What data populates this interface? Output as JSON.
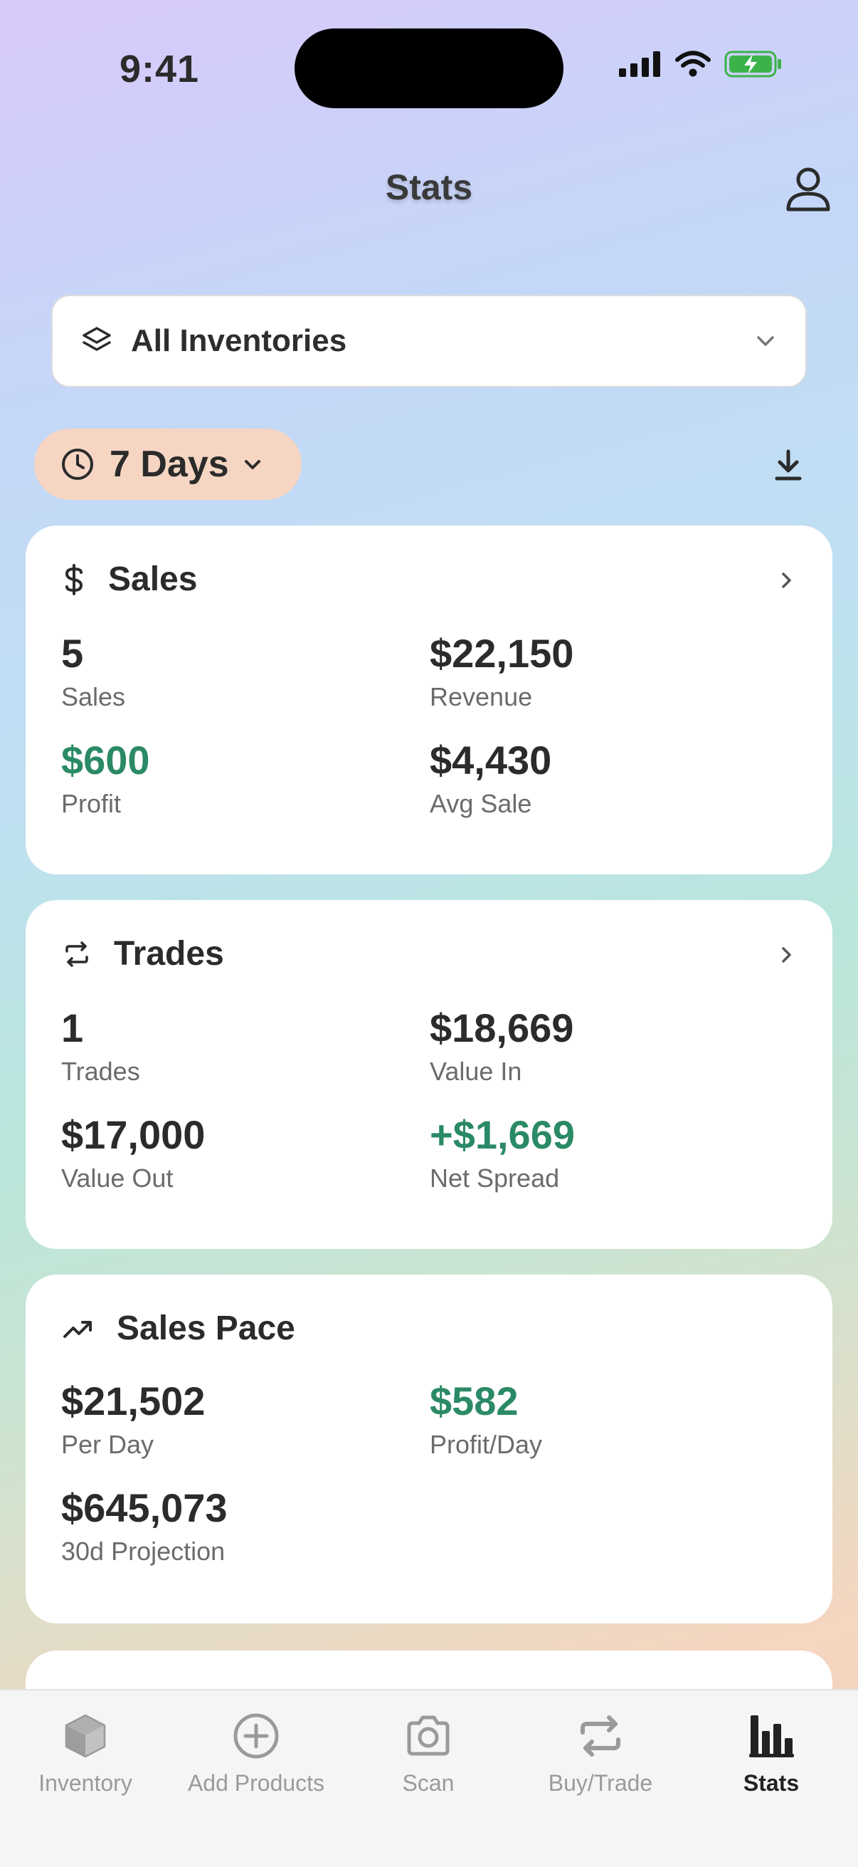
{
  "status_bar": {
    "time": "9:41"
  },
  "header": {
    "title": "Stats"
  },
  "inventory_selector": {
    "label": "All Inventories"
  },
  "date_range": {
    "label": "7 Days"
  },
  "sales_card": {
    "title": "Sales",
    "metrics": [
      {
        "value": "5",
        "caption": "Sales"
      },
      {
        "value": "$22,150",
        "caption": "Revenue"
      },
      {
        "value": "$600",
        "caption": "Profit"
      },
      {
        "value": "$4,430",
        "caption": "Avg Sale"
      }
    ]
  },
  "trades_card": {
    "title": "Trades",
    "metrics": [
      {
        "value": "1",
        "caption": "Trades"
      },
      {
        "value": "$18,669",
        "caption": "Value In"
      },
      {
        "value": "$17,000",
        "caption": "Value Out"
      },
      {
        "value": "+$1,669",
        "caption": "Net Spread"
      }
    ]
  },
  "pace_card": {
    "title": "Sales Pace",
    "metrics": [
      {
        "value": "$21,502",
        "caption": "Per Day"
      },
      {
        "value": "$582",
        "caption": "Profit/Day"
      },
      {
        "value": "$645,073",
        "caption": "30d Projection"
      }
    ]
  },
  "tabs": [
    {
      "label": "Inventory",
      "icon": "box-icon"
    },
    {
      "label": "Add Products",
      "icon": "plus-circle-icon"
    },
    {
      "label": "Scan",
      "icon": "camera-icon"
    },
    {
      "label": "Buy/Trade",
      "icon": "repeat-icon"
    },
    {
      "label": "Stats",
      "icon": "bar-chart-icon",
      "active": true
    }
  ],
  "colors": {
    "positive": "#2b8a66",
    "range_pill": "#f6d6c3",
    "battery": "#3cb34a"
  }
}
